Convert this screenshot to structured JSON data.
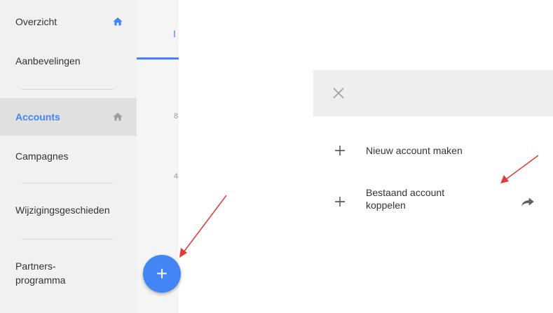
{
  "sidebar": {
    "items": [
      {
        "label": "Overzicht"
      },
      {
        "label": "Aanbevelingen"
      },
      {
        "label": "Accounts"
      },
      {
        "label": "Campagnes"
      },
      {
        "label": "Wijzigingsgeschieden"
      },
      {
        "label": "Partners-"
      },
      {
        "label": "programma"
      }
    ]
  },
  "middle": {
    "tab_fragment": "I",
    "num1": "8",
    "num2": "4"
  },
  "fab": {
    "label": "+"
  },
  "panel": {
    "items": [
      {
        "label": "Nieuw account maken"
      },
      {
        "label_line1": "Bestaand account",
        "label_line2": "koppelen"
      }
    ]
  },
  "colors": {
    "accent": "#4285f4",
    "annotation_arrow": "#e53935"
  }
}
